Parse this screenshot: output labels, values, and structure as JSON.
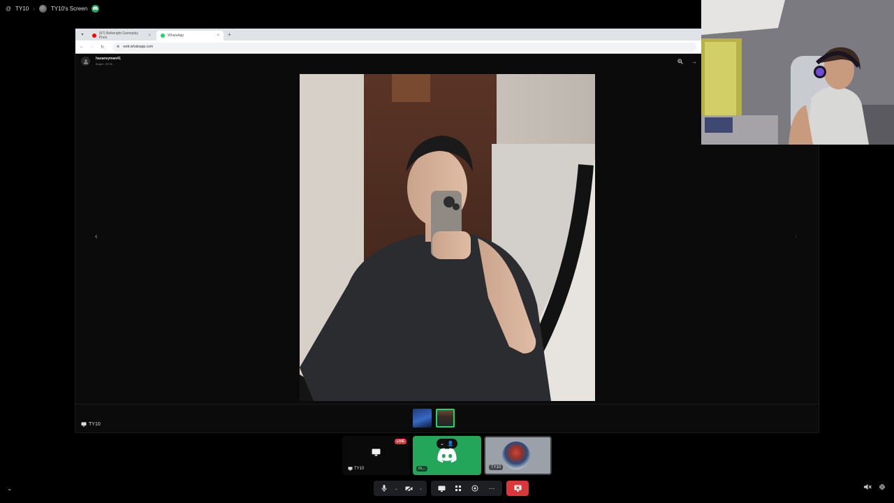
{
  "topbar": {
    "server_prefix": "@",
    "user": "TY10",
    "separator": "›",
    "screen_title": "TY10's Screen"
  },
  "browser": {
    "tabs": [
      {
        "label": "(67) Bellwright Gameplay Previ",
        "active": false,
        "favicon_color": "#ff0000"
      },
      {
        "label": "WhatsApp",
        "active": true,
        "favicon_color": "#25d366"
      }
    ],
    "url": "web.whatsapp.com"
  },
  "whatsapp_viewer": {
    "contact_name": "hasaneyman41",
    "timestamp": "Bugün, 02:56"
  },
  "stream": {
    "streamer_tag": "TY10"
  },
  "tiles": [
    {
      "label": "TY10",
      "live_badge": "LIVE",
      "kind": "screen-share"
    },
    {
      "label": "m...",
      "kind": "discord-user",
      "bg": "#23a55a"
    },
    {
      "label": "TY10",
      "kind": "camera-avatar"
    }
  ],
  "colors": {
    "discord_green": "#23a55a",
    "whatsapp_green": "#25d366",
    "danger_red": "#da373c"
  }
}
